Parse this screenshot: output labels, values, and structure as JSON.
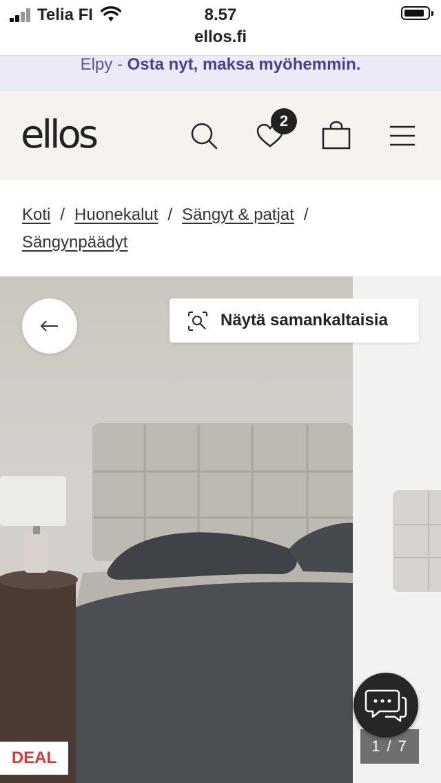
{
  "status_bar": {
    "carrier": "Telia FI",
    "time": "8.57",
    "url": "ellos.fi"
  },
  "promo": {
    "prefix": "Elpy - ",
    "highlight": "Osta nyt, maksa myöhemmin."
  },
  "header": {
    "logo": "ellos",
    "wishlist_count": "2"
  },
  "breadcrumb": {
    "items": [
      "Koti",
      "Huonekalut",
      "Sängyt & patjat",
      "Sängynpäädyt"
    ],
    "separator": "/"
  },
  "gallery": {
    "similar_button_label": "Näytä samankaltaisia",
    "badge": "DEAL",
    "counter": "1 / 7"
  },
  "colors": {
    "promo_bg": "#ebeaf7",
    "promo_text": "#4b3f91",
    "header_bg": "#f6f3ef",
    "deal_red": "#d63a3a"
  },
  "icons": [
    "signal-icon",
    "wifi-icon",
    "battery-icon",
    "search-icon",
    "heart-icon",
    "bag-icon",
    "menu-icon",
    "arrow-left-icon",
    "visual-search-icon",
    "chat-icon"
  ]
}
